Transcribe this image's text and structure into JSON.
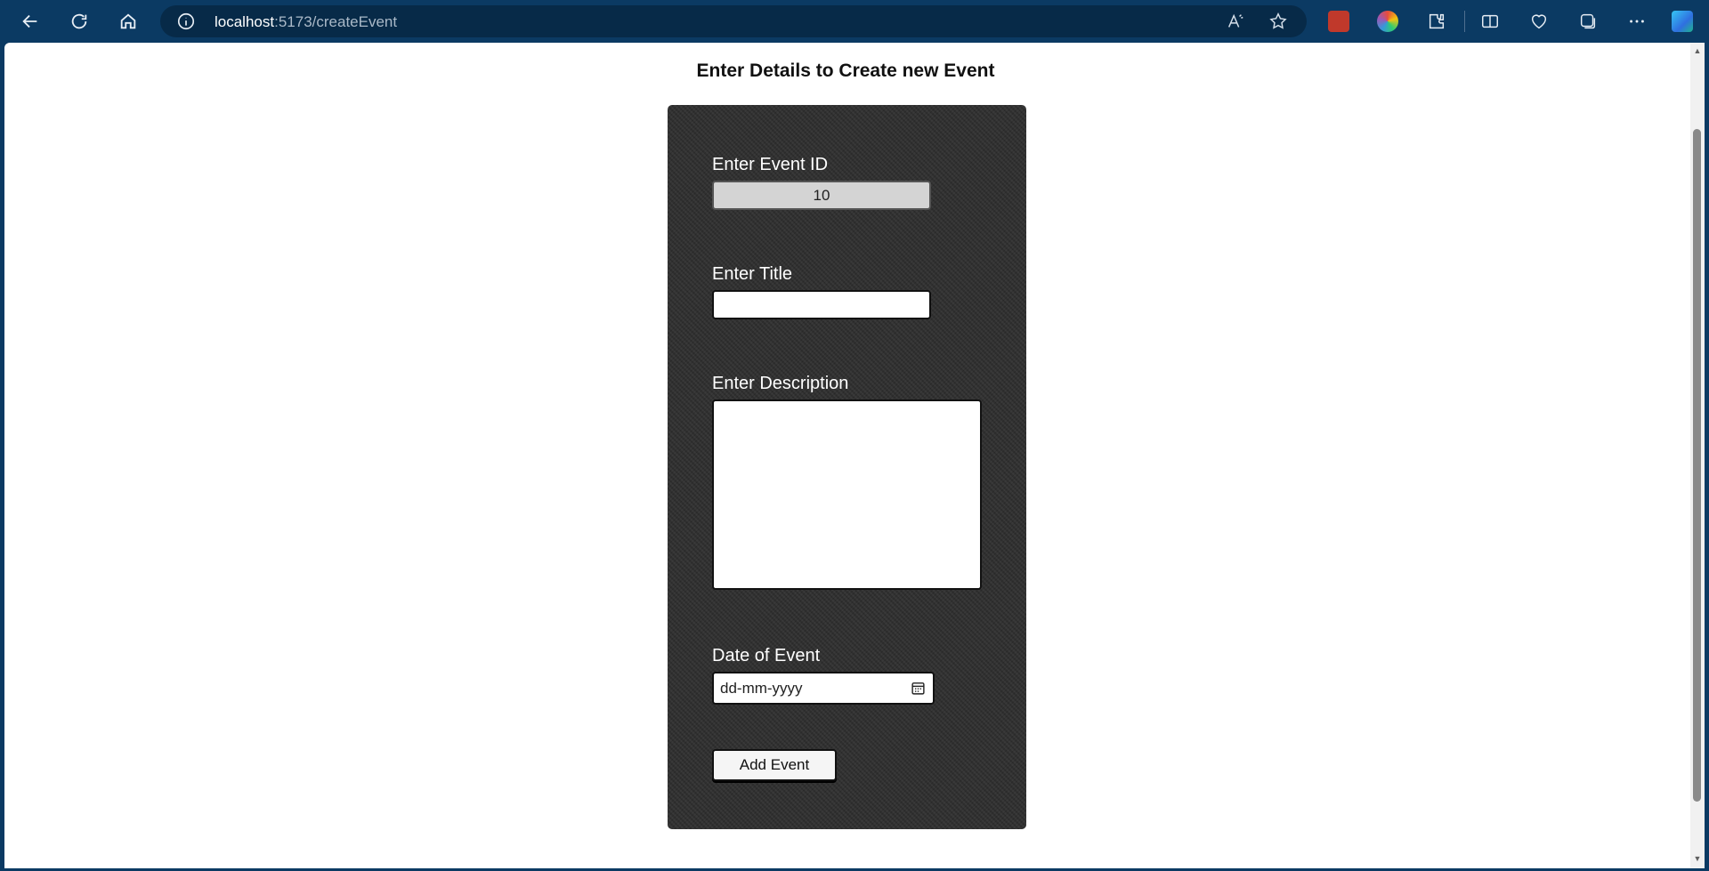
{
  "browser": {
    "url_host": "localhost",
    "url_path": ":5173/createEvent"
  },
  "page": {
    "title": "Enter Details to Create new Event"
  },
  "form": {
    "event_id_label": "Enter Event ID",
    "event_id_value": "10",
    "title_label": "Enter Title",
    "title_value": "",
    "description_label": "Enter Description",
    "description_value": "",
    "date_label": "Date of Event",
    "date_placeholder": "dd-mm-yyyy",
    "submit_label": "Add Event"
  },
  "colors": {
    "chrome": "#0b3a63",
    "card": "#2e2e2e"
  }
}
